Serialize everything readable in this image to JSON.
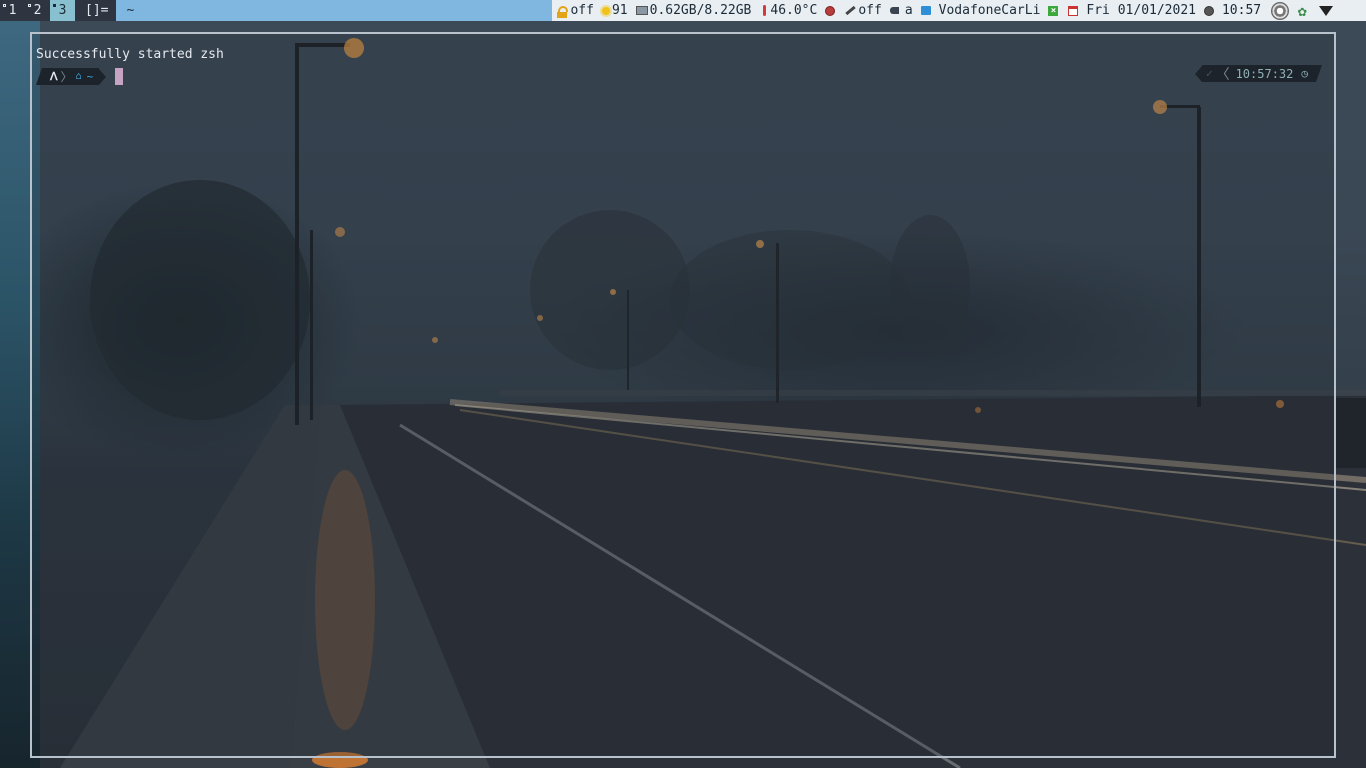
{
  "workspaces": [
    {
      "label": "1",
      "active": false
    },
    {
      "label": "2",
      "active": false
    },
    {
      "label": "3",
      "active": true
    }
  ],
  "layout_symbol": "[]=",
  "window_title": "~",
  "status": {
    "caps_lock": "off",
    "brightness": "91",
    "memory": "0.62GB/8.22GB",
    "temperature": "46.0°C",
    "mic": "off",
    "volume": "a",
    "network": "VodafoneCarLi",
    "date": "Fri 01/01/2021",
    "time": "10:57"
  },
  "terminal": {
    "output_line": "Successfully started zsh",
    "prompt_dir": "~",
    "right_time": "10:57:32"
  },
  "icons": {
    "lock": "lock-icon",
    "brightness": "sun-icon",
    "memory": "memory-icon",
    "temperature": "thermometer-icon",
    "mic": "microphone-icon",
    "volume": "volume-icon",
    "network": "wifi-signal-icon",
    "battery": "x-icon",
    "calendar": "calendar-icon",
    "clock": "clock-icon"
  },
  "colors": {
    "bar_bg": "#2e3440",
    "title_bg": "#7fb7e0",
    "status_bg": "#e8eef2",
    "terminal_border": "#b7c2cc",
    "cursor": "#c8a4c4",
    "prompt_dir": "#3fa7e0"
  }
}
